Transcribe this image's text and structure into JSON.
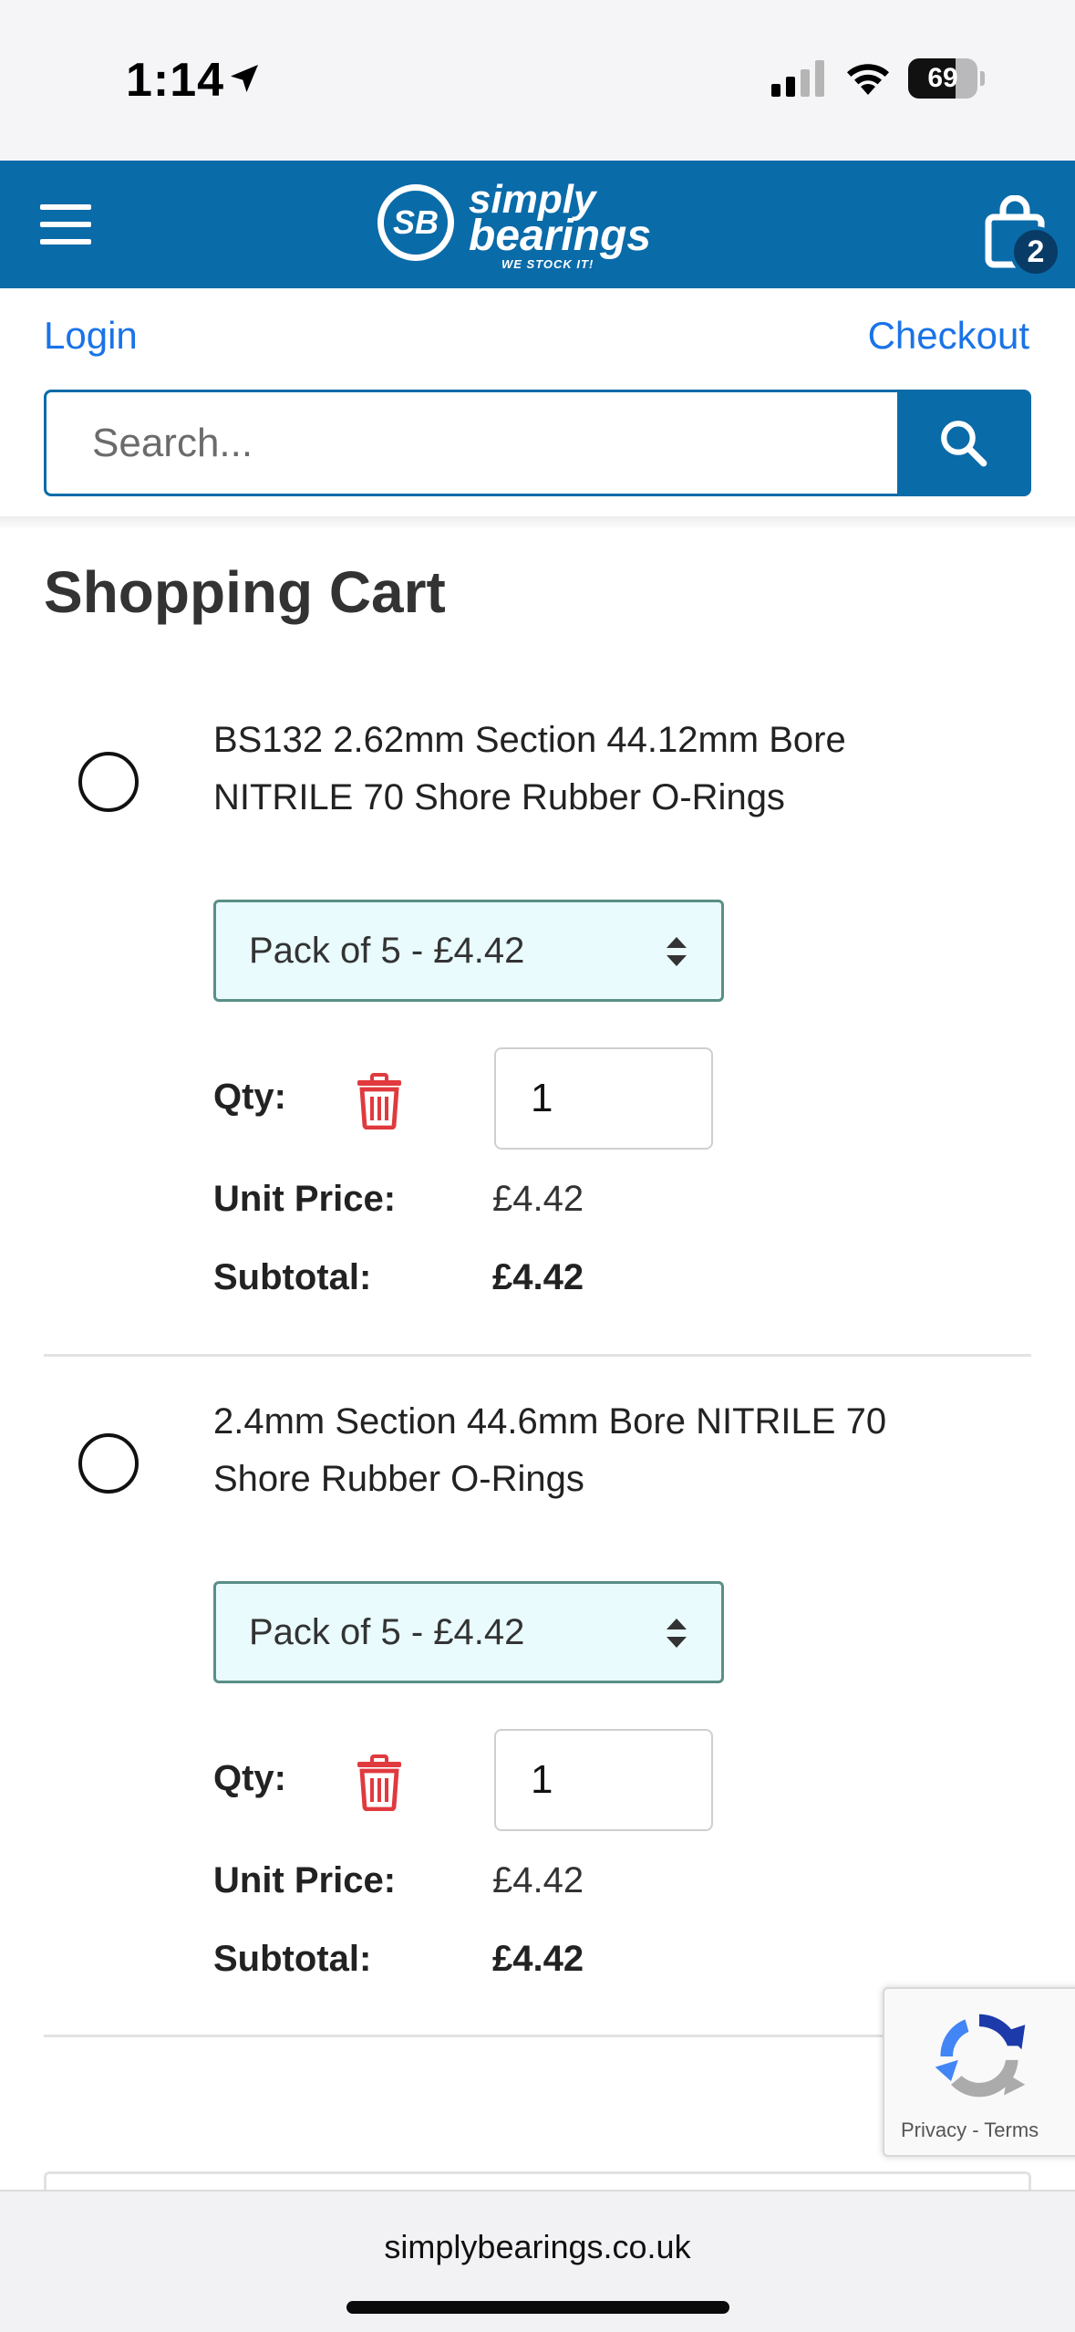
{
  "status_bar": {
    "time": "1:14",
    "battery": "69",
    "battery_level": 0.69
  },
  "header": {
    "logo_line1": "simply",
    "logo_line2": "bearings",
    "logo_mark": "SB",
    "logo_tagline": "WE STOCK IT!",
    "cart_count": "2",
    "brand_color": "#0a6ba9"
  },
  "account": {
    "login_label": "Login",
    "checkout_label": "Checkout"
  },
  "search": {
    "placeholder": "Search..."
  },
  "page_title": "Shopping Cart",
  "labels": {
    "qty": "Qty:",
    "unit_price": "Unit Price:",
    "subtotal": "Subtotal:"
  },
  "cart_items": [
    {
      "name": "BS132 2.62mm Section 44.12mm Bore NITRILE 70 Shore Rubber O-Rings",
      "pack_option": "Pack of 5 - £4.42",
      "qty": "1",
      "unit_price": "£4.42",
      "subtotal": "£4.42"
    },
    {
      "name": "2.4mm Section 44.6mm Bore NITRILE 70 Shore Rubber O-Rings",
      "pack_option": "Pack of 5 - £4.42",
      "qty": "1",
      "unit_price": "£4.42",
      "subtotal": "£4.42"
    }
  ],
  "recaptcha": {
    "privacy": "Privacy",
    "separator": " - ",
    "terms": "Terms"
  },
  "browser": {
    "url": "simplybearings.co.uk"
  },
  "icons": {
    "menu": "hamburger-icon",
    "cart": "shopping-bag-icon",
    "search": "search-icon",
    "delete": "trash-icon",
    "select": "updown-chevron-icon"
  }
}
